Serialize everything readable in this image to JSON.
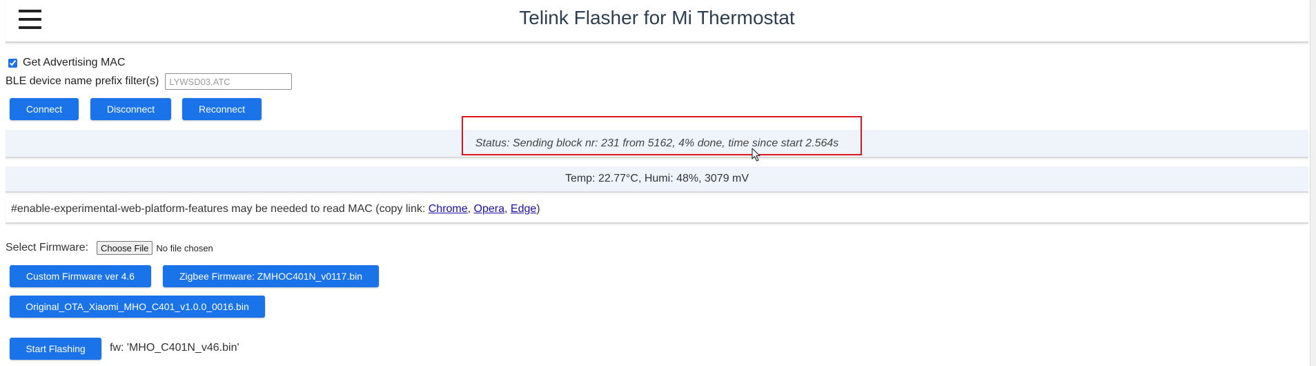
{
  "app": {
    "title": "Telink Flasher for Mi Thermostat"
  },
  "connection": {
    "advertising_mac_label": "Get Advertising MAC",
    "advertising_mac_checked": true,
    "name_filter_label": "BLE device name prefix filter(s)",
    "name_filter_placeholder": "LYWSD03,ATC",
    "name_filter_value": "",
    "connect_label": "Connect",
    "disconnect_label": "Disconnect",
    "reconnect_label": "Reconnect"
  },
  "status": {
    "text": "Status: Sending block nr: 231 from 5162, 4% done, time since start 2.564s"
  },
  "sensor": {
    "text": "Temp: 22.77°C, Humi: 48%, 3079 mV"
  },
  "flags": {
    "prefix": "#enable-experimental-web-platform-features may be needed to read MAC (copy link: ",
    "links": [
      "Chrome",
      "Opera",
      "Edge"
    ],
    "sep": ", ",
    "suffix": ")"
  },
  "firmware": {
    "select_label": "Select Firmware:",
    "choose_file_label": "Choose File",
    "file_status": "No file chosen",
    "custom_button": "Custom Firmware ver 4.6",
    "zigbee_button": "Zigbee Firmware: ZMHOC401N_v0117.bin",
    "original_button": "Original_OTA_Xiaomi_MHO_C401_v1.0.0_0016.bin",
    "start_button": "Start Flashing",
    "current_fw": "fw: 'MHO_C401N_v46.bin'"
  },
  "colors": {
    "button": "#1a73e8",
    "panel_bg": "#eff4fb",
    "highlight": "#e0161f"
  },
  "icons": {
    "menu": "hamburger-menu-icon",
    "cursor": "mouse-pointer-icon"
  }
}
